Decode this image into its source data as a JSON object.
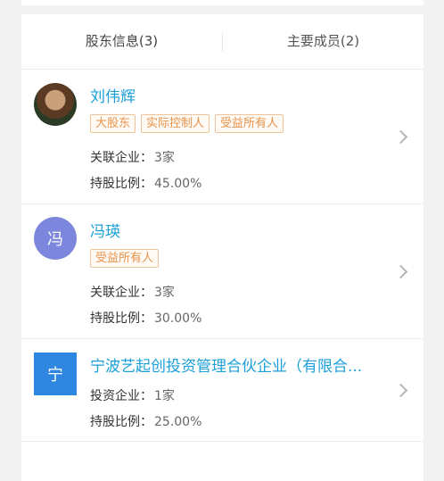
{
  "tabs": [
    {
      "label": "股东信息(3)"
    },
    {
      "label": "主要成员(2)"
    }
  ],
  "shareholders": [
    {
      "name": "刘伟辉",
      "avatar_type": "photo",
      "tags": [
        "大股东",
        "实际控制人",
        "受益所有人"
      ],
      "row1_label": "关联企业：",
      "row1_value": "3家",
      "row2_label": "持股比例：",
      "row2_value": "45.00%"
    },
    {
      "name": "冯瑛",
      "avatar_type": "letter",
      "avatar_text": "冯",
      "tags": [
        "受益所有人"
      ],
      "row1_label": "关联企业：",
      "row1_value": "3家",
      "row2_label": "持股比例：",
      "row2_value": "30.00%"
    },
    {
      "name": "宁波艺起创投资管理合伙企业（有限合...",
      "avatar_type": "square",
      "avatar_text": "宁",
      "tags": [],
      "row1_label": "投资企业：",
      "row1_value": "1家",
      "row2_label": "持股比例：",
      "row2_value": "25.00%"
    }
  ],
  "colors": {
    "name_link": "#1c9fd9",
    "tag_orange": "#e8934a",
    "avatar_purple": "#7b86dc",
    "avatar_blue": "#2f86e0"
  },
  "icons": {
    "row_arrow": "chevron-right-icon"
  }
}
